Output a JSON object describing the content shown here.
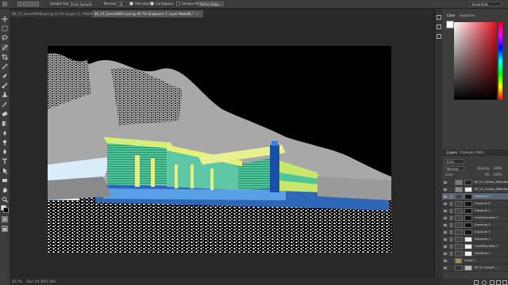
{
  "options_bar": {
    "sample_size_label": "Sample Size:",
    "sample_size_value": "Point Sample",
    "tolerance_label": "Tolerance:",
    "tolerance_value": "32",
    "antialias_label": "Anti-alias",
    "contiguous_label": "Contiguous",
    "sample_all_label": "Sample All Layers",
    "refine_edge_label": "Refine Edge...",
    "workspace_label": "Essentials"
  },
  "tabs": [
    {
      "label": "BS_V1_Sunset0000.psd @ 12.5% (Layer 11, RGB/8)",
      "active": false
    },
    {
      "label": "BS_V1_Sunset0001.psd @ 40.7% (Exposure 7, Layer Mask/8) *",
      "active": true
    }
  ],
  "status_bar": {
    "zoom": "40.7%",
    "doc_info": "Doc: 64.3M/1.18G"
  },
  "panels": {
    "color_tab": "Color",
    "swatches_tab": "Swatches",
    "layers_tab": "Layers",
    "channels_tab": "Channels",
    "paths_tab": "Paths",
    "filter_kind": "Kind",
    "blend_mode": "Normal",
    "opacity_label": "Opacity:",
    "opacity_value": "100%",
    "lock_label": "Lock:",
    "fill_label": "Fill:",
    "fill_value": "100%"
  },
  "layers": [
    {
      "name": "BS_V1_Sunset_ZRendering_2...",
      "kind": "layer"
    },
    {
      "name": "BS_V1_Sunset_ZRendering_2...",
      "kind": "layer"
    },
    {
      "name": "Exposure 7",
      "kind": "adjust",
      "selected": true
    },
    {
      "name": "Exposure 6",
      "kind": "adjust"
    },
    {
      "name": "Exposure 5",
      "kind": "adjust"
    },
    {
      "name": "Hue/Saturation 2",
      "kind": "adjust"
    },
    {
      "name": "Exposure 4",
      "kind": "adjust"
    },
    {
      "name": "Exposure 3",
      "kind": "adjust"
    },
    {
      "name": "Exposure 1",
      "kind": "adjust"
    },
    {
      "name": "Hue/Saturation 1",
      "kind": "adjust"
    },
    {
      "name": "Exposure 2",
      "kind": "adjust"
    },
    {
      "name": "Group 1",
      "kind": "group"
    },
    {
      "name": "BS_V1_Sunset_...",
      "kind": "layer"
    }
  ],
  "colors": {
    "foreground": "#ffffff",
    "background": "#000000",
    "selected_layer": "#596676"
  }
}
